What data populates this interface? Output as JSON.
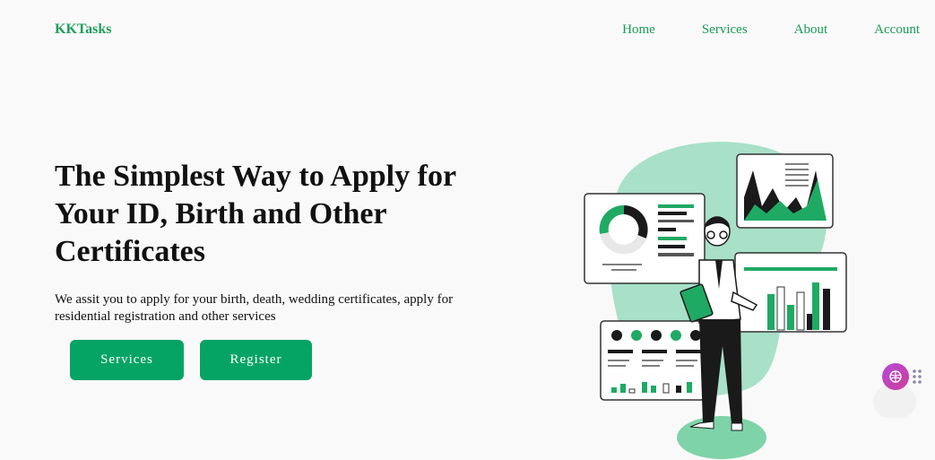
{
  "header": {
    "brand": "KKTasks",
    "nav": [
      "Home",
      "Services",
      "About",
      "Account"
    ]
  },
  "hero": {
    "title": "The Simplest Way to Apply for Your ID, Birth and Other Certificates",
    "subtitle": "We assit you to apply for your birth, death, wedding certificates, apply for residential registration and other services",
    "buttons": {
      "services": "Services",
      "register": "Register"
    }
  },
  "colors": {
    "brand": "#1f9d5a",
    "button": "#06a464",
    "mint": "#a8e0c8"
  },
  "icons": {
    "widget": "brain-icon",
    "dots": "grip-dots-icon"
  }
}
